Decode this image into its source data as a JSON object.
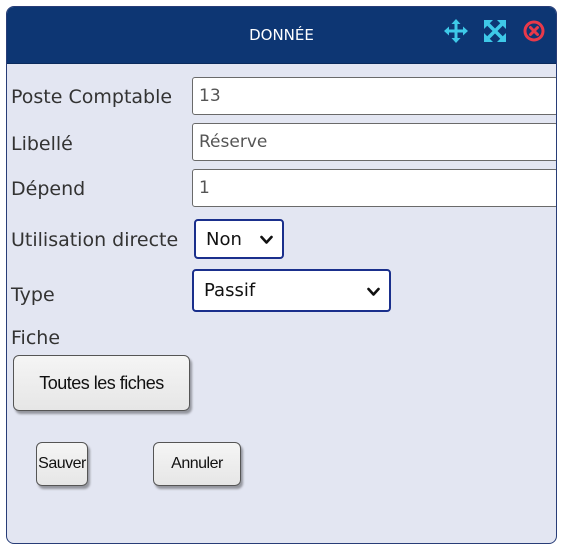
{
  "dialog": {
    "title": "DONNÉE",
    "icons": [
      "move-icon",
      "expand-icon",
      "close-icon"
    ],
    "colors": {
      "titlebar": "#0d3673",
      "move_icon": "#3ec9e8",
      "expand_icon": "#3ec9e8",
      "close_icon": "#e8394a",
      "panel": "#e3e6f2"
    }
  },
  "form": {
    "poste_label": "Poste Comptable",
    "poste_value": "13",
    "libelle_label": "Libellé",
    "libelle_value": "Réserve",
    "depend_label": "Dépend",
    "depend_value": "1",
    "utilisation_label": "Utilisation directe",
    "utilisation_value": "Non",
    "type_label": "Type",
    "type_value": "Passif",
    "fiche_label": "Fiche"
  },
  "buttons": {
    "toutes_fiches": "Toutes les fiches",
    "sauver": "Sauver",
    "annuler": "Annuler"
  }
}
